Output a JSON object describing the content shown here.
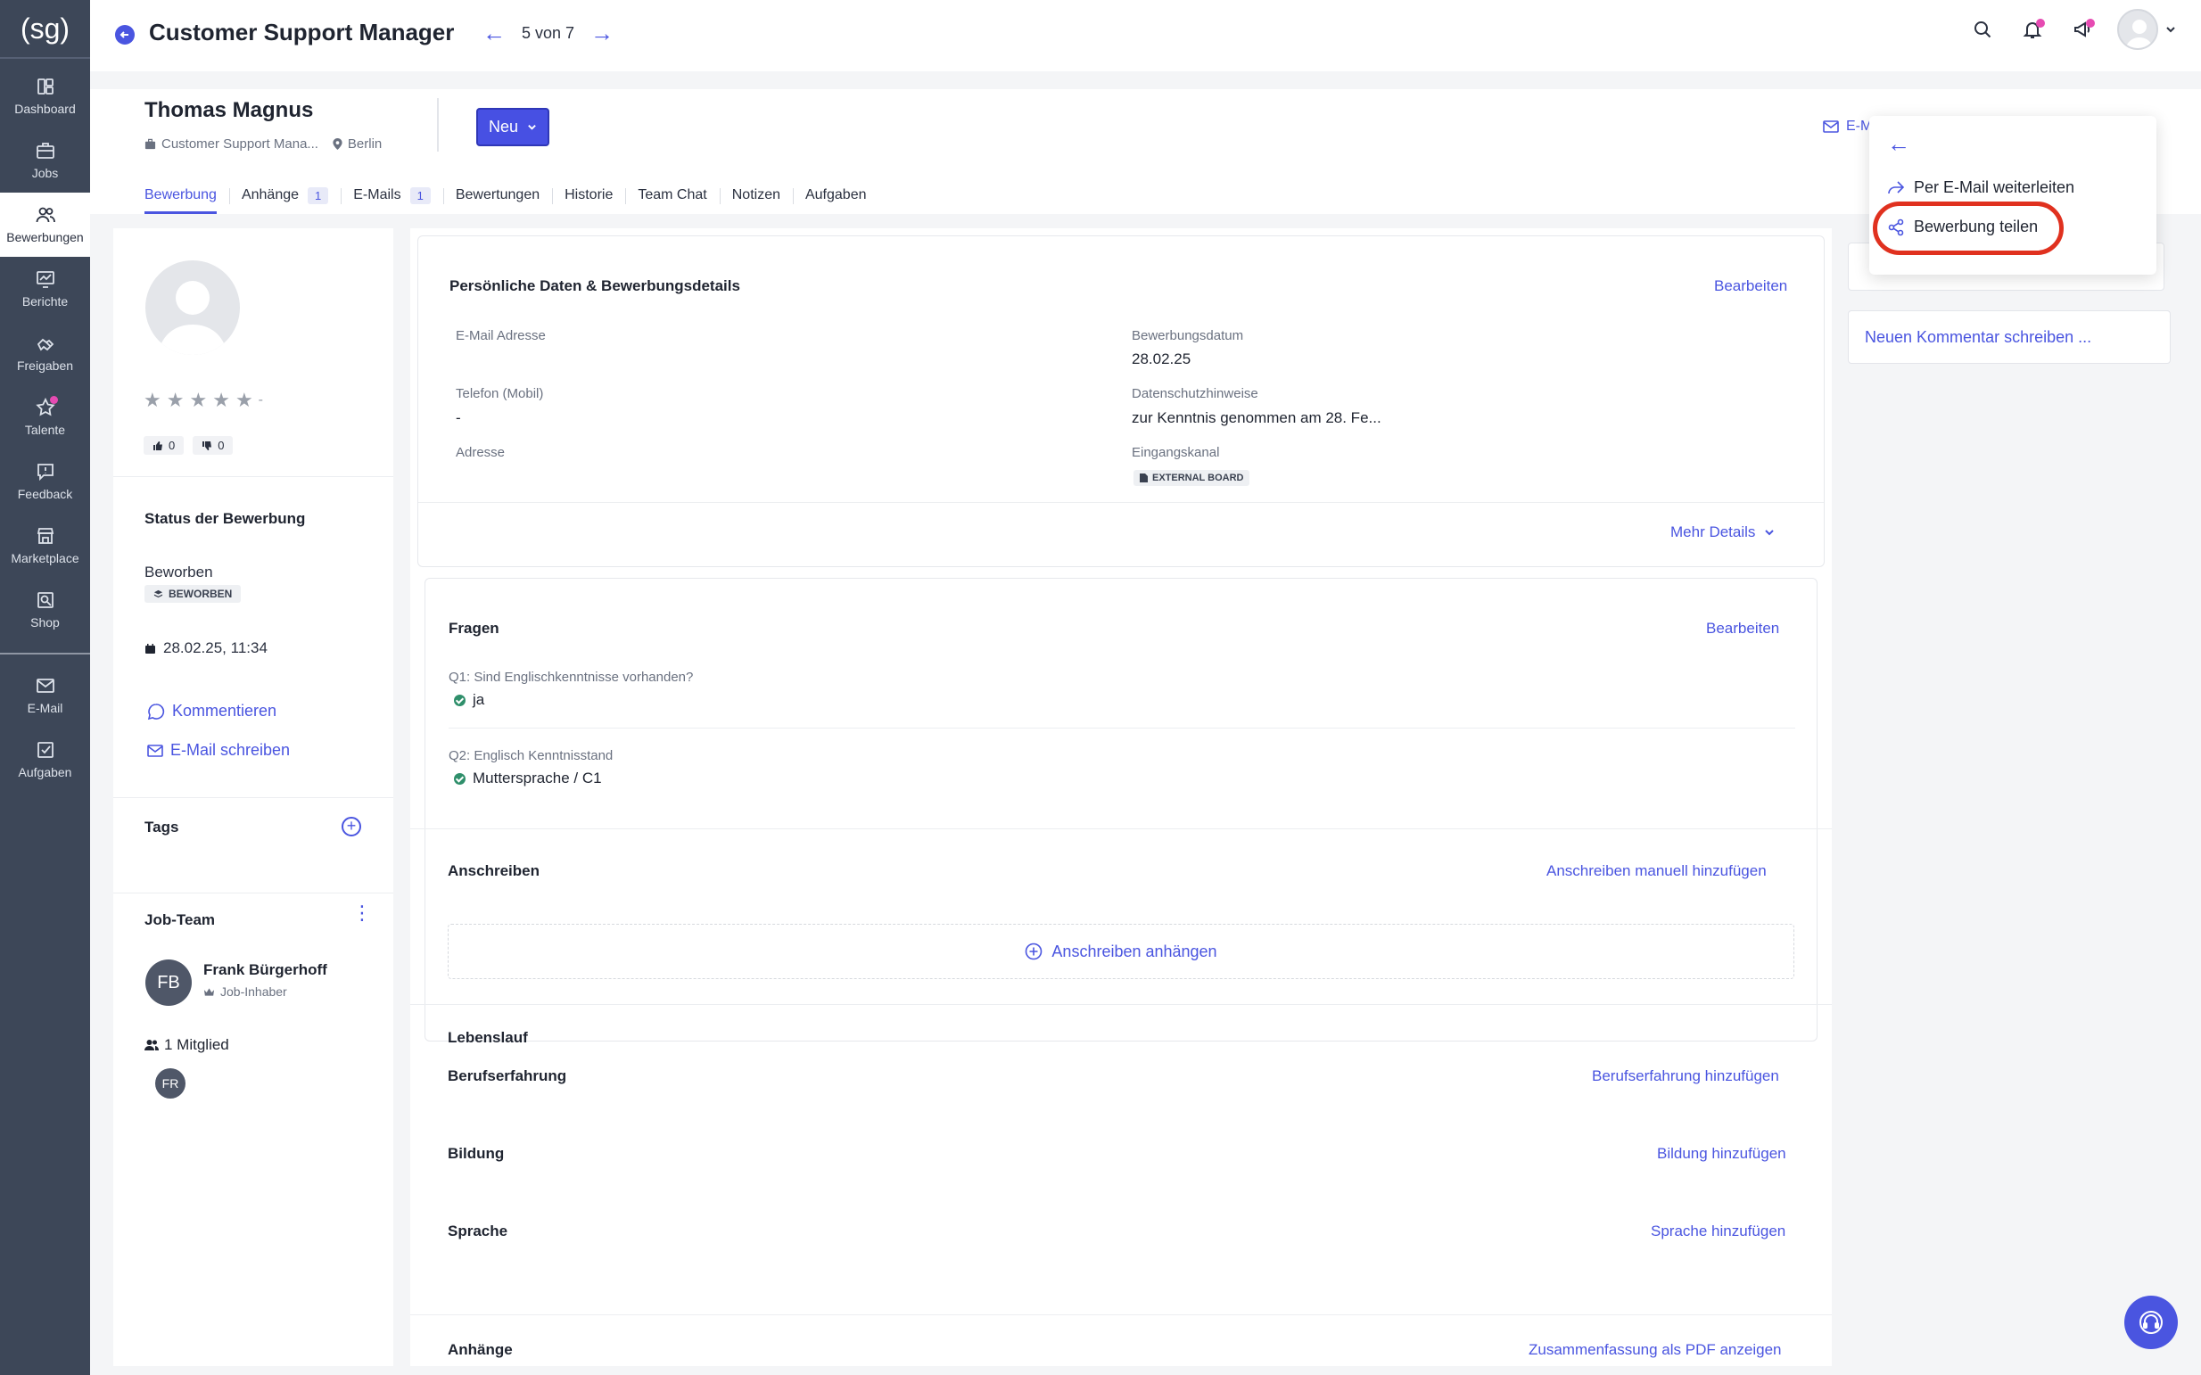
{
  "sidebar": {
    "logo": "(sg)",
    "items": [
      {
        "label": "Dashboard"
      },
      {
        "label": "Jobs"
      },
      {
        "label": "Bewerbungen"
      },
      {
        "label": "Berichte"
      },
      {
        "label": "Freigaben"
      },
      {
        "label": "Talente"
      },
      {
        "label": "Feedback"
      },
      {
        "label": "Marketplace"
      },
      {
        "label": "Shop"
      },
      {
        "label": "E-Mail"
      },
      {
        "label": "Aufgaben"
      }
    ]
  },
  "header": {
    "job_title": "Customer Support Manager",
    "pager": "5 von 7"
  },
  "candidate": {
    "name": "Thomas Magnus",
    "job": "Customer Support Mana...",
    "location": "Berlin",
    "status_button": "Neu",
    "email_link": "E-M",
    "tabs": [
      {
        "label": "Bewerbung"
      },
      {
        "label": "Anhänge",
        "badge": "1"
      },
      {
        "label": "E-Mails",
        "badge": "1"
      },
      {
        "label": "Bewertungen"
      },
      {
        "label": "Historie"
      },
      {
        "label": "Team Chat"
      },
      {
        "label": "Notizen"
      },
      {
        "label": "Aufgaben"
      }
    ]
  },
  "left": {
    "rating_dash": "-",
    "thumbs_up": "0",
    "thumbs_down": "0",
    "status_heading": "Status der Bewerbung",
    "status_text": "Beworben",
    "status_chip": "BEWORBEN",
    "date": "28.02.25, 11:34",
    "comment_link": "Kommentieren",
    "email_link": "E-Mail schreiben",
    "tags_heading": "Tags",
    "team_heading": "Job-Team",
    "owner_initials": "FB",
    "owner_name": "Frank Bürgerhoff",
    "owner_role": "Job-Inhaber",
    "members": "1 Mitglied",
    "member_initials": "FR"
  },
  "main": {
    "personal": {
      "heading": "Persönliche Daten & Bewerbungsdetails",
      "edit": "Bearbeiten",
      "email_label": "E-Mail Adresse",
      "phone_label": "Telefon (Mobil)",
      "phone_value": "-",
      "address_label": "Adresse",
      "date_label": "Bewerbungsdatum",
      "date_value": "28.02.25",
      "privacy_label": "Datenschutzhinweise",
      "privacy_value": "zur Kenntnis genommen am 28. Fe...",
      "channel_label": "Eingangskanal",
      "channel_value": "EXTERNAL BOARD",
      "more": "Mehr Details"
    },
    "questions": {
      "heading": "Fragen",
      "edit": "Bearbeiten",
      "q1": "Q1: Sind Englischkenntnisse vorhanden?",
      "a1": "ja",
      "q2": "Q2: Englisch Kenntnisstand",
      "a2": "Muttersprache / C1"
    },
    "cover": {
      "heading": "Anschreiben",
      "add_manual": "Anschreiben manuell hinzufügen",
      "attach": "Anschreiben anhängen"
    },
    "cv": {
      "heading": "Lebenslauf",
      "work": "Berufserfahrung",
      "work_add": "Berufserfahrung hinzufügen",
      "edu": "Bildung",
      "edu_add": "Bildung hinzufügen",
      "lang": "Sprache",
      "lang_add": "Sprache hinzufügen"
    },
    "attachments": {
      "heading": "Anhänge",
      "pdf": "Zusammenfassung als PDF anzeigen"
    }
  },
  "right": {
    "comment_placeholder": "Neuen Kommentar schreiben ..."
  },
  "dropdown": {
    "forward": "Per E-Mail weiterleiten",
    "share": "Bewerbung teilen"
  },
  "colors": {
    "accent": "#4a55e0",
    "sidebar": "#3d4758",
    "highlight": "#e0311f",
    "notification": "#e64bb2"
  }
}
